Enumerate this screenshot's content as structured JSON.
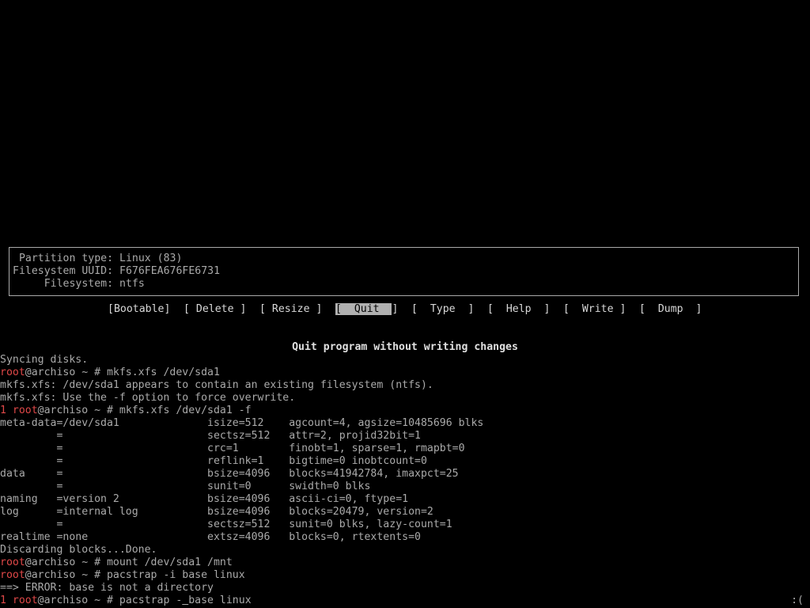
{
  "info": {
    "rows": [
      {
        "label": " Partition type:",
        "value": "Linux (83)"
      },
      {
        "label": "Filesystem UUID:",
        "value": "F676FEA676FE6731"
      },
      {
        "label": "     Filesystem:",
        "value": "ntfs"
      }
    ]
  },
  "menu": {
    "bootable": "[Bootable]",
    "delete": "[ Delete ]",
    "resize": "[ Resize ]",
    "quit_open": "[",
    "quit_label": "  Quit  ",
    "quit_close": "]",
    "type": "[  Type  ]",
    "help": "[  Help  ]",
    "write": "[  Write ]",
    "dump": "[  Dump  ]"
  },
  "hint": "Quit program without writing changes",
  "terminal": {
    "l1": "Syncing disks.",
    "p_root": "root",
    "p_rest": "@archiso ~ # ",
    "err_num": "1 ",
    "c1": "mkfs.xfs /dev/sda1",
    "l3": "mkfs.xfs: /dev/sda1 appears to contain an existing filesystem (ntfs).",
    "l4": "mkfs.xfs: Use the -f option to force overwrite.",
    "c2": "mkfs.xfs /dev/sda1 -f",
    "m1": "meta-data=/dev/sda1              isize=512    agcount=4, agsize=10485696 blks",
    "m2": "         =                       sectsz=512   attr=2, projid32bit=1",
    "m3": "         =                       crc=1        finobt=1, sparse=1, rmapbt=0",
    "m4": "         =                       reflink=1    bigtime=0 inobtcount=0",
    "m5": "data     =                       bsize=4096   blocks=41942784, imaxpct=25",
    "m6": "         =                       sunit=0      swidth=0 blks",
    "m7": "naming   =version 2              bsize=4096   ascii-ci=0, ftype=1",
    "m8": "log      =internal log           bsize=4096   blocks=20479, version=2",
    "m9": "         =                       sectsz=512   sunit=0 blks, lazy-count=1",
    "m10": "realtime =none                   extsz=4096   blocks=0, rtextents=0",
    "l15": "Discarding blocks...Done.",
    "c3": "mount /dev/sda1 /mnt",
    "c4": "pacstrap -i base linux",
    "l18": "==> ERROR: base is not a directory",
    "c5a": "pacstrap -",
    "c5cursor": " ",
    "c5b": "base linux",
    "status": ":("
  }
}
